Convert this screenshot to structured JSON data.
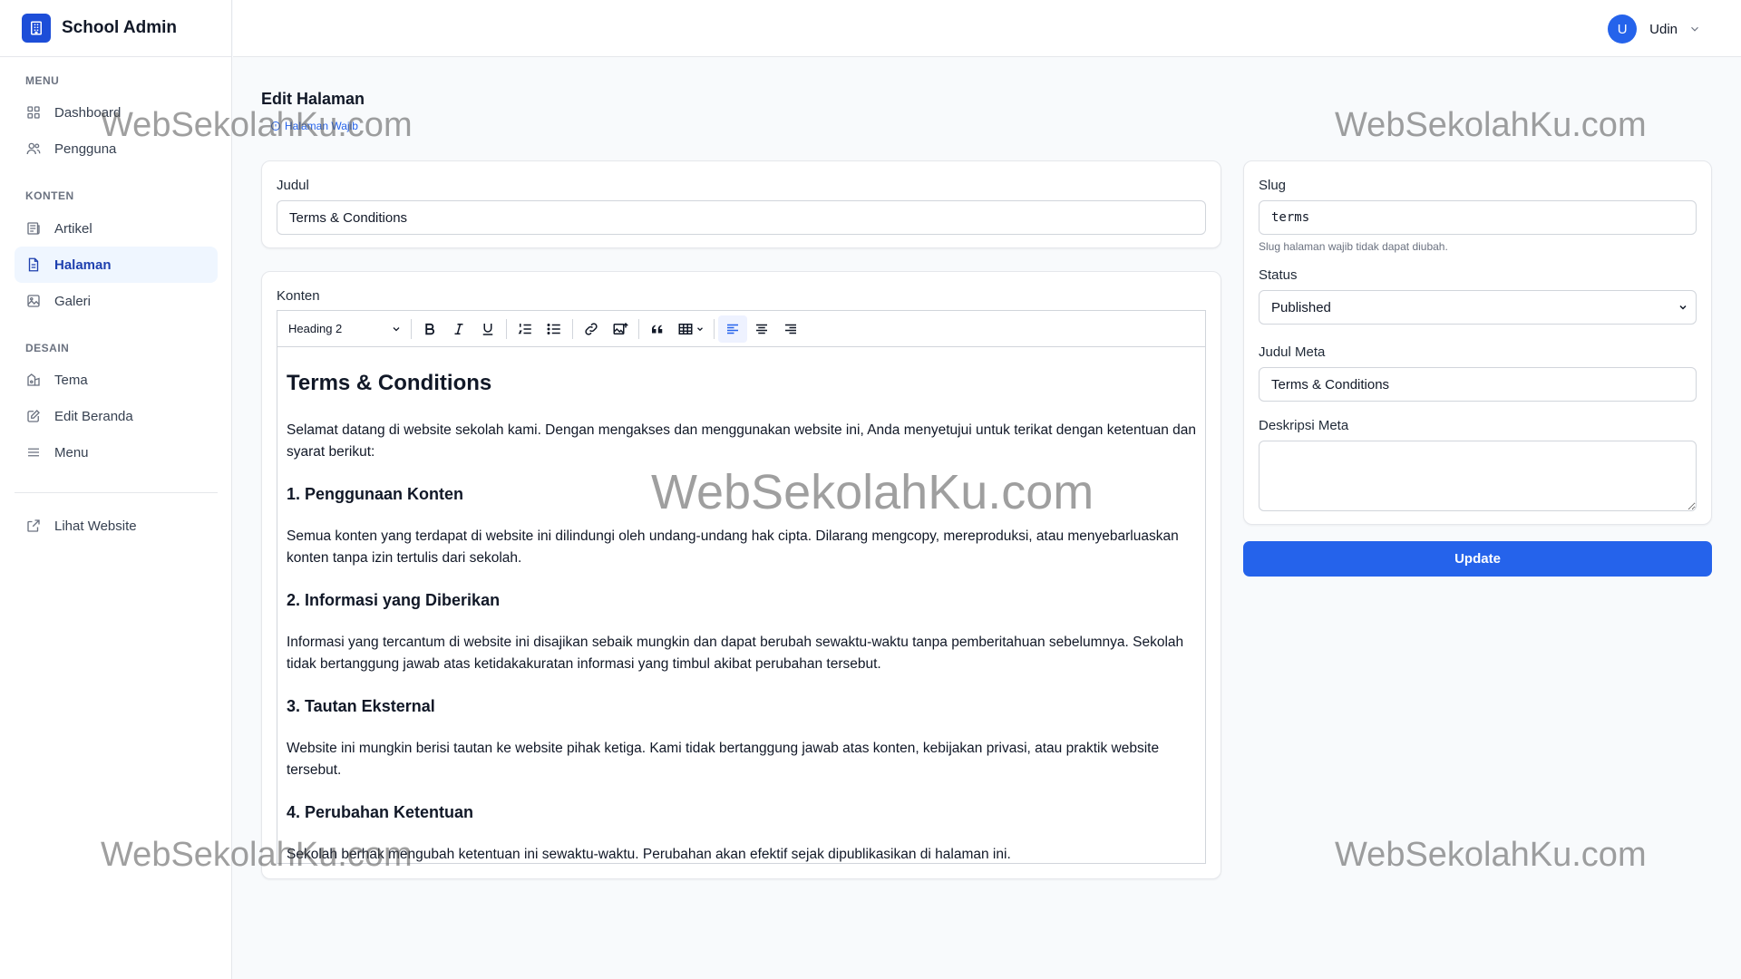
{
  "app": {
    "title": "School Admin"
  },
  "user": {
    "initial": "U",
    "name": "Udin"
  },
  "sidebar": {
    "sections": [
      {
        "title": "MENU"
      },
      {
        "title": "KONTEN"
      },
      {
        "title": "DESAIN"
      }
    ],
    "items": [
      {
        "label": "Dashboard",
        "icon": "grid-icon"
      },
      {
        "label": "Pengguna",
        "icon": "users-icon"
      },
      {
        "label": "Artikel",
        "icon": "newspaper-icon"
      },
      {
        "label": "Halaman",
        "icon": "document-icon",
        "active": true
      },
      {
        "label": "Galeri",
        "icon": "image-icon"
      },
      {
        "label": "Tema",
        "icon": "palette-icon"
      },
      {
        "label": "Edit Beranda",
        "icon": "edit-icon"
      },
      {
        "label": "Menu",
        "icon": "menu-icon"
      },
      {
        "label": "Lihat Website",
        "icon": "external-link-icon"
      }
    ]
  },
  "page": {
    "title": "Edit Halaman",
    "badge": "Halaman Wajib"
  },
  "form": {
    "judul_label": "Judul",
    "judul_value": "Terms & Conditions",
    "konten_label": "Konten",
    "slug_label": "Slug",
    "slug_value": "terms",
    "slug_hint": "Slug halaman wajib tidak dapat diubah.",
    "status_label": "Status",
    "status_value": "Published",
    "meta_title_label": "Judul Meta",
    "meta_title_value": "Terms & Conditions",
    "meta_desc_label": "Deskripsi Meta",
    "meta_desc_value": "",
    "update_label": "Update"
  },
  "editor": {
    "heading_select": "Heading 2",
    "content": {
      "h1": "Terms & Conditions",
      "p0": "Selamat datang di website sekolah kami. Dengan mengakses dan menggunakan website ini, Anda menyetujui untuk terikat dengan ketentuan dan syarat berikut:",
      "h2_1": "1. Penggunaan Konten",
      "p1": "Semua konten yang terdapat di website ini dilindungi oleh undang-undang hak cipta. Dilarang mengcopy, mereproduksi, atau menyebarluaskan konten tanpa izin tertulis dari sekolah.",
      "h2_2": "2. Informasi yang Diberikan",
      "p2": "Informasi yang tercantum di website ini disajikan sebaik mungkin dan dapat berubah sewaktu-waktu tanpa pemberitahuan sebelumnya. Sekolah tidak bertanggung jawab atas ketidakakuratan informasi yang timbul akibat perubahan tersebut.",
      "h2_3": "3. Tautan Eksternal",
      "p3": "Website ini mungkin berisi tautan ke website pihak ketiga. Kami tidak bertanggung jawab atas konten, kebijakan privasi, atau praktik website tersebut.",
      "h2_4": "4. Perubahan Ketentuan",
      "p4": "Sekolah berhak mengubah ketentuan ini sewaktu-waktu. Perubahan akan efektif sejak dipublikasikan di halaman ini."
    }
  },
  "watermark": "WebSekolahKu.com",
  "colors": {
    "primary": "#2563eb",
    "active_bg": "#eff6ff"
  }
}
